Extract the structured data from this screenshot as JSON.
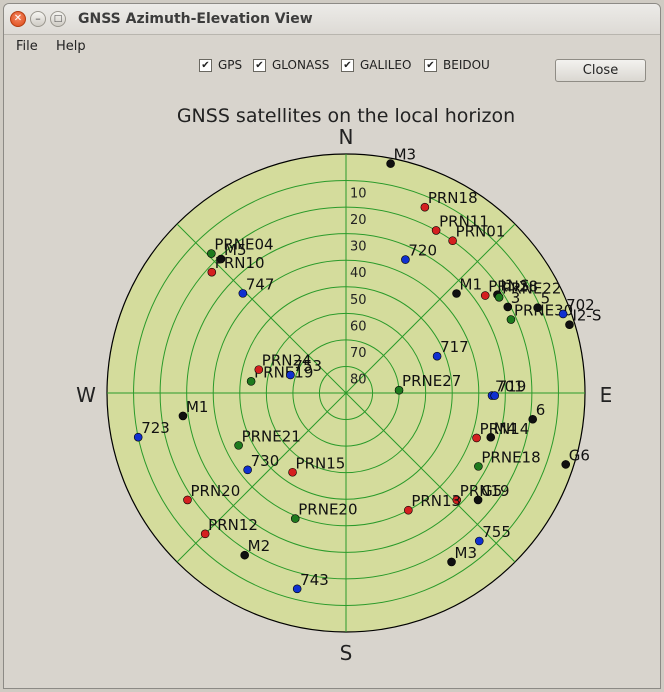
{
  "window": {
    "title": "GNSS Azimuth-Elevation View"
  },
  "menu": {
    "file": "File",
    "help": "Help"
  },
  "filters": [
    {
      "label": "GPS",
      "checked": true
    },
    {
      "label": "GLONASS",
      "checked": true
    },
    {
      "label": "GALILEO",
      "checked": true
    },
    {
      "label": "BEIDOU",
      "checked": true
    }
  ],
  "buttons": {
    "close": "Close"
  },
  "plot": {
    "title": "GNSS satellites on the local horizon",
    "directions": {
      "n": "N",
      "s": "S",
      "e": "E",
      "w": "W"
    },
    "rings": [
      "10",
      "20",
      "30",
      "40",
      "50",
      "60",
      "70",
      "80"
    ],
    "colors": {
      "background": "#d4dc9c",
      "grid": "#2a9a2a",
      "gps": "#d42020",
      "glonass": "#101010",
      "galileo": "#1e7a1e",
      "beidou": "#1030d0"
    }
  },
  "chart_data": {
    "type": "scatter",
    "coordinate_system": "polar azimuth/elevation",
    "title": "GNSS satellites on the local horizon",
    "satellites": [
      {
        "label": "M3",
        "system": "glonass",
        "az": 11,
        "el": 2
      },
      {
        "label": "PRN18",
        "system": "gps",
        "az": 23,
        "el": 14
      },
      {
        "label": "PRN11",
        "system": "gps",
        "az": 29,
        "el": 20
      },
      {
        "label": "PRN01",
        "system": "gps",
        "az": 35,
        "el": 20
      },
      {
        "label": "720",
        "system": "beidou",
        "az": 24,
        "el": 35
      },
      {
        "label": "M1",
        "system": "glonass",
        "az": 48,
        "el": 34
      },
      {
        "label": "PRN28",
        "system": "gps",
        "az": 55,
        "el": 26
      },
      {
        "label": "I1-S",
        "system": "glonass",
        "az": 57,
        "el": 22
      },
      {
        "label": "PRNE22",
        "system": "galileo",
        "az": 58,
        "el": 22
      },
      {
        "label": "3",
        "system": "glonass",
        "az": 62,
        "el": 21
      },
      {
        "label": "5",
        "system": "glonass",
        "az": 66,
        "el": 11
      },
      {
        "label": "PRNE30",
        "system": "galileo",
        "az": 66,
        "el": 22
      },
      {
        "label": "702",
        "system": "beidou",
        "az": 70,
        "el": 3
      },
      {
        "label": "I2-S",
        "system": "glonass",
        "az": 73,
        "el": 2
      },
      {
        "label": "717",
        "system": "beidou",
        "az": 68,
        "el": 53
      },
      {
        "label": "PRNE27",
        "system": "galileo",
        "az": 87,
        "el": 70
      },
      {
        "label": "701",
        "system": "beidou",
        "az": 91,
        "el": 35
      },
      {
        "label": "719",
        "system": "beidou",
        "az": 91,
        "el": 34
      },
      {
        "label": "6",
        "system": "glonass",
        "az": 98,
        "el": 19
      },
      {
        "label": "M4",
        "system": "glonass",
        "az": 107,
        "el": 33
      },
      {
        "label": "PRN14",
        "system": "gps",
        "az": 109,
        "el": 38
      },
      {
        "label": "PRNE18",
        "system": "galileo",
        "az": 119,
        "el": 33
      },
      {
        "label": "G6",
        "system": "glonass",
        "az": 108,
        "el": 3
      },
      {
        "label": "PRN19",
        "system": "gps",
        "az": 134,
        "el": 32
      },
      {
        "label": "G5",
        "system": "glonass",
        "az": 129,
        "el": 26
      },
      {
        "label": "755",
        "system": "beidou",
        "az": 138,
        "el": 15
      },
      {
        "label": "PRN13",
        "system": "gps",
        "az": 152,
        "el": 40
      },
      {
        "label": "M3",
        "system": "glonass",
        "az": 148,
        "el": 15
      },
      {
        "label": "PRNE20",
        "system": "galileo",
        "az": 202,
        "el": 39
      },
      {
        "label": "743",
        "system": "beidou",
        "az": 194,
        "el": 14
      },
      {
        "label": "PRN15",
        "system": "gps",
        "az": 214,
        "el": 54
      },
      {
        "label": "PRN20",
        "system": "gps",
        "az": 236,
        "el": 18
      },
      {
        "label": "PRN12",
        "system": "gps",
        "az": 225,
        "el": 15
      },
      {
        "label": "M2",
        "system": "glonass",
        "az": 212,
        "el": 18
      },
      {
        "label": "730",
        "system": "beidou",
        "az": 232,
        "el": 43
      },
      {
        "label": "PRNE21",
        "system": "galileo",
        "az": 244,
        "el": 45
      },
      {
        "label": "723",
        "system": "beidou",
        "az": 258,
        "el": 10
      },
      {
        "label": "M1",
        "system": "glonass",
        "az": 262,
        "el": 28
      },
      {
        "label": "PRNE19",
        "system": "galileo",
        "az": 277,
        "el": 54
      },
      {
        "label": "PRN24",
        "system": "gps",
        "az": 285,
        "el": 56
      },
      {
        "label": "753",
        "system": "beidou",
        "az": 288,
        "el": 68
      },
      {
        "label": "PRNE04",
        "system": "galileo",
        "az": 316,
        "el": 17
      },
      {
        "label": "M5",
        "system": "glonass",
        "az": 317,
        "el": 21
      },
      {
        "label": "PRN10",
        "system": "gps",
        "az": 312,
        "el": 22
      },
      {
        "label": "747",
        "system": "beidou",
        "az": 314,
        "el": 36
      }
    ]
  }
}
